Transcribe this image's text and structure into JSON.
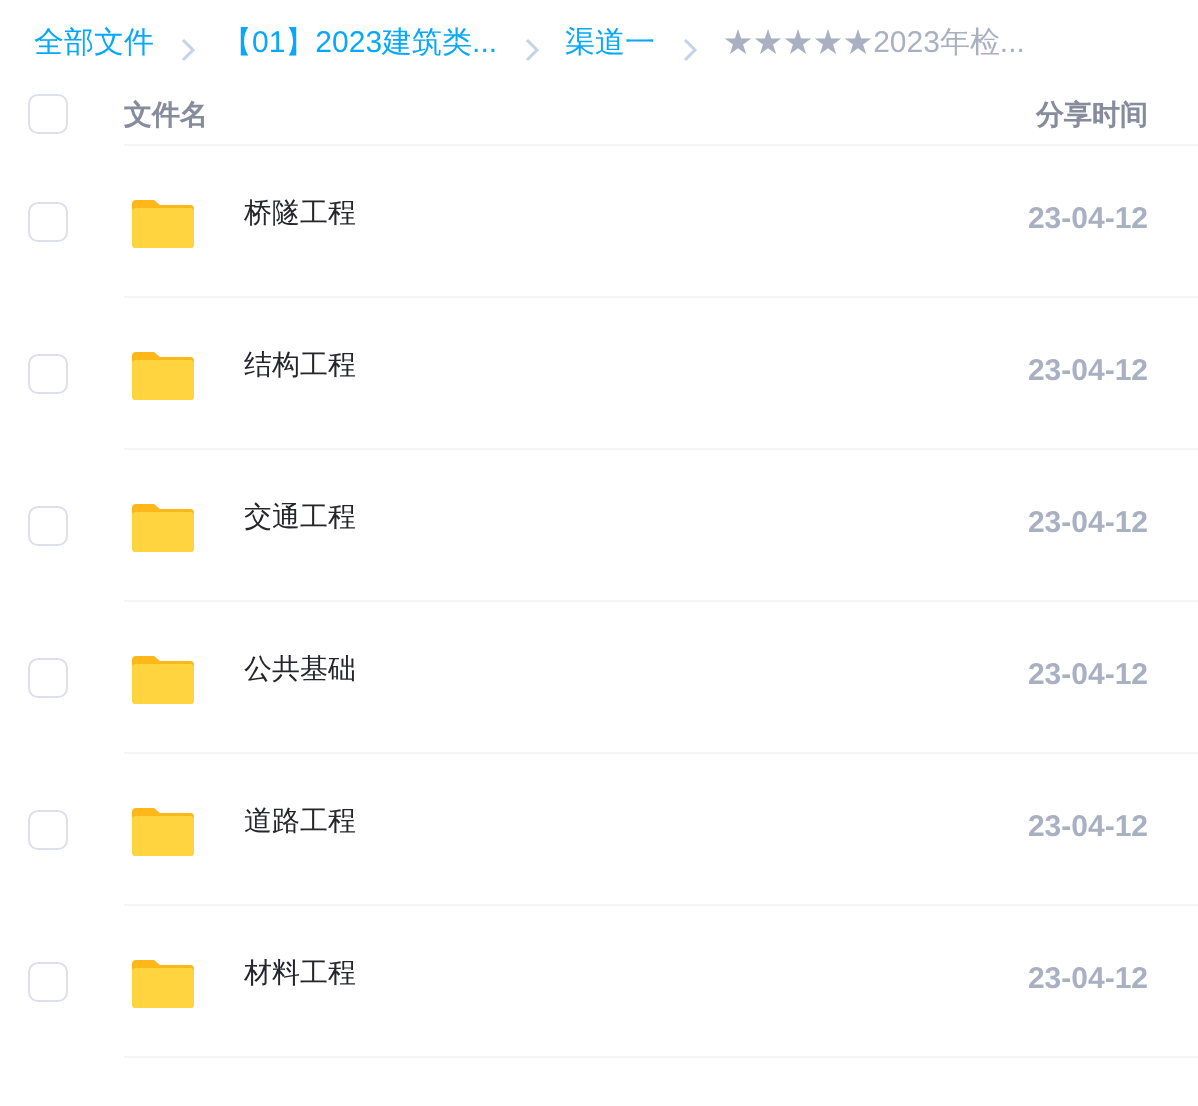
{
  "breadcrumb": [
    {
      "label": "全部文件",
      "current": false
    },
    {
      "label": "【01】2023建筑类...",
      "current": false
    },
    {
      "label": "渠道一",
      "current": false
    },
    {
      "label": "★★★★★2023年检...",
      "current": true
    }
  ],
  "table": {
    "select_all": {
      "checked": false
    },
    "columns": [
      "文件名",
      "分享时间"
    ],
    "rows": [
      {
        "name": "桥隧工程",
        "date": "23-04-12",
        "checked": false
      },
      {
        "name": "结构工程",
        "date": "23-04-12",
        "checked": false
      },
      {
        "name": "交通工程",
        "date": "23-04-12",
        "checked": false
      },
      {
        "name": "公共基础",
        "date": "23-04-12",
        "checked": false
      },
      {
        "name": "道路工程",
        "date": "23-04-12",
        "checked": false
      },
      {
        "name": "材料工程",
        "date": "23-04-12",
        "checked": false
      }
    ]
  }
}
